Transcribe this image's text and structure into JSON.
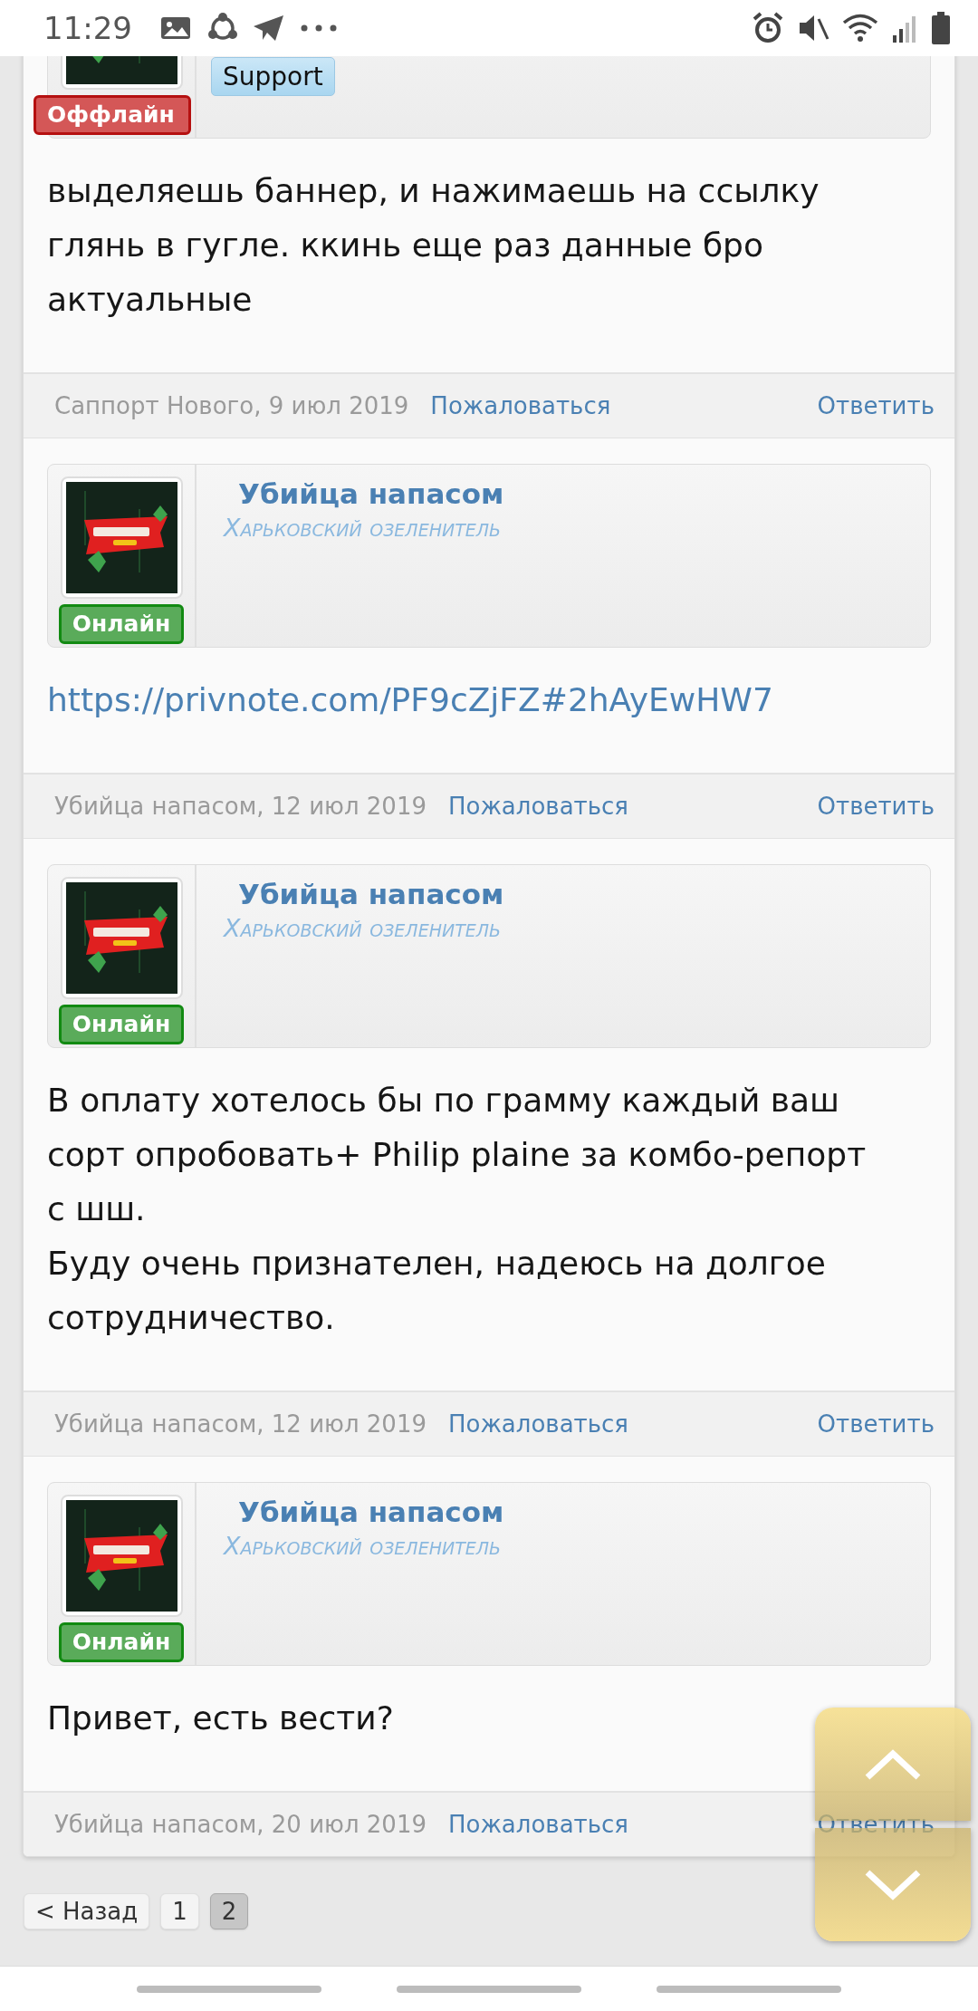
{
  "status_bar": {
    "time": "11:29"
  },
  "posts": [
    {
      "banner": "Support",
      "avatar": {
        "kind": "picture"
      },
      "online": false,
      "status_label": "Оффлайн",
      "kind": "text",
      "paragraphs": [
        "выделяешь баннер, и нажимаешь на ссылку глянь в гугле. ккинь еще раз данные бро актуальные"
      ],
      "byline": "Саппорт Нового, 9 июл 2019",
      "report": "Пожаловаться",
      "reply": "Ответить"
    },
    {
      "author": "Убийца напасом",
      "user_title": "Харьковский озеленитель",
      "avatar": {
        "kind": "picture"
      },
      "online": true,
      "status_label": "Онлайн",
      "kind": "link",
      "paragraphs": [
        "https://privnote.com/PF9cZjFZ#2hAyEwHW7"
      ],
      "byline": "Убийца напасом, 12 июл 2019",
      "report": "Пожаловаться",
      "reply": "Ответить"
    },
    {
      "author": "Убийца напасом",
      "user_title": "Харьковский озеленитель",
      "avatar": {
        "kind": "picture"
      },
      "online": true,
      "status_label": "Онлайн",
      "kind": "text",
      "paragraphs": [
        "В оплату хотелось бы по грамму каждый ваш сорт опробовать+ Philip plaine за комбо-репорт с шш.",
        "Буду очень признателен, надеюсь на долгое сотрудничество."
      ],
      "byline": "Убийца напасом, 12 июл 2019",
      "report": "Пожаловаться",
      "reply": "Ответить"
    },
    {
      "author": "Убийца напасом",
      "user_title": "Харьковский озеленитель",
      "avatar": {
        "kind": "picture"
      },
      "online": true,
      "status_label": "Онлайн",
      "kind": "text",
      "paragraphs": [
        "Привет, есть вести?"
      ],
      "byline": "Убийца напасом, 20 июл 2019",
      "report": "Пожаловаться",
      "reply": "Ответить"
    }
  ],
  "pagination": {
    "previous": "< Назад",
    "pages": [
      {
        "label": "1",
        "selected": false
      },
      {
        "label": "2",
        "selected": true
      }
    ]
  }
}
